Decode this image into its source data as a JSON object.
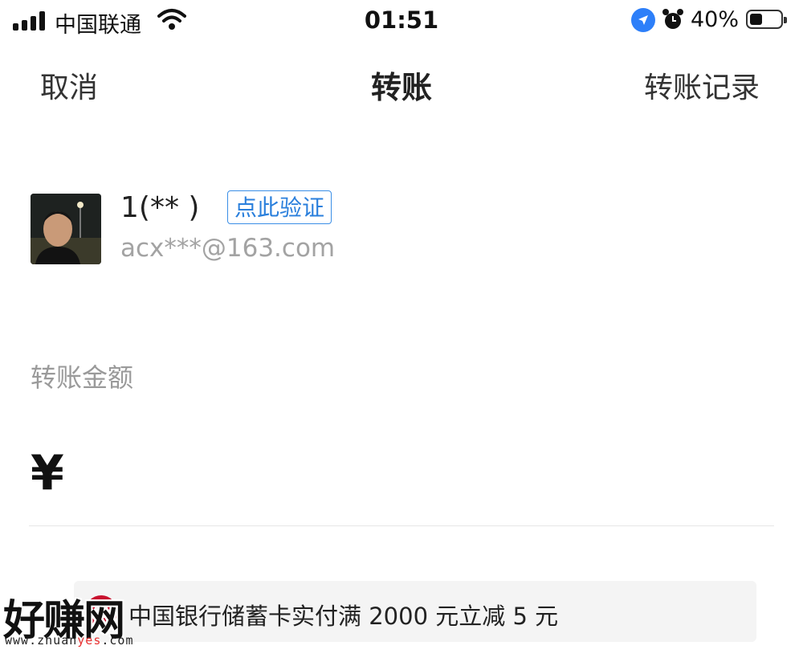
{
  "status_bar": {
    "carrier": "中国联通",
    "time": "01:51",
    "battery": "40%",
    "battery_level": 0.4
  },
  "nav": {
    "cancel": "取消",
    "title": "转账",
    "history": "转账记录"
  },
  "payee": {
    "name": "1(**    )",
    "verify": "点此验证",
    "account": "acx***@163.com"
  },
  "amount": {
    "label": "转账金额",
    "currency": "¥",
    "value": ""
  },
  "promo": {
    "text": "中国银行储蓄卡实付满 2000 元立减 5 元"
  },
  "watermark": {
    "main": "好赚网",
    "url_prefix": "www.zhuan",
    "url_yes": "yes",
    "url_suffix": ".com"
  }
}
